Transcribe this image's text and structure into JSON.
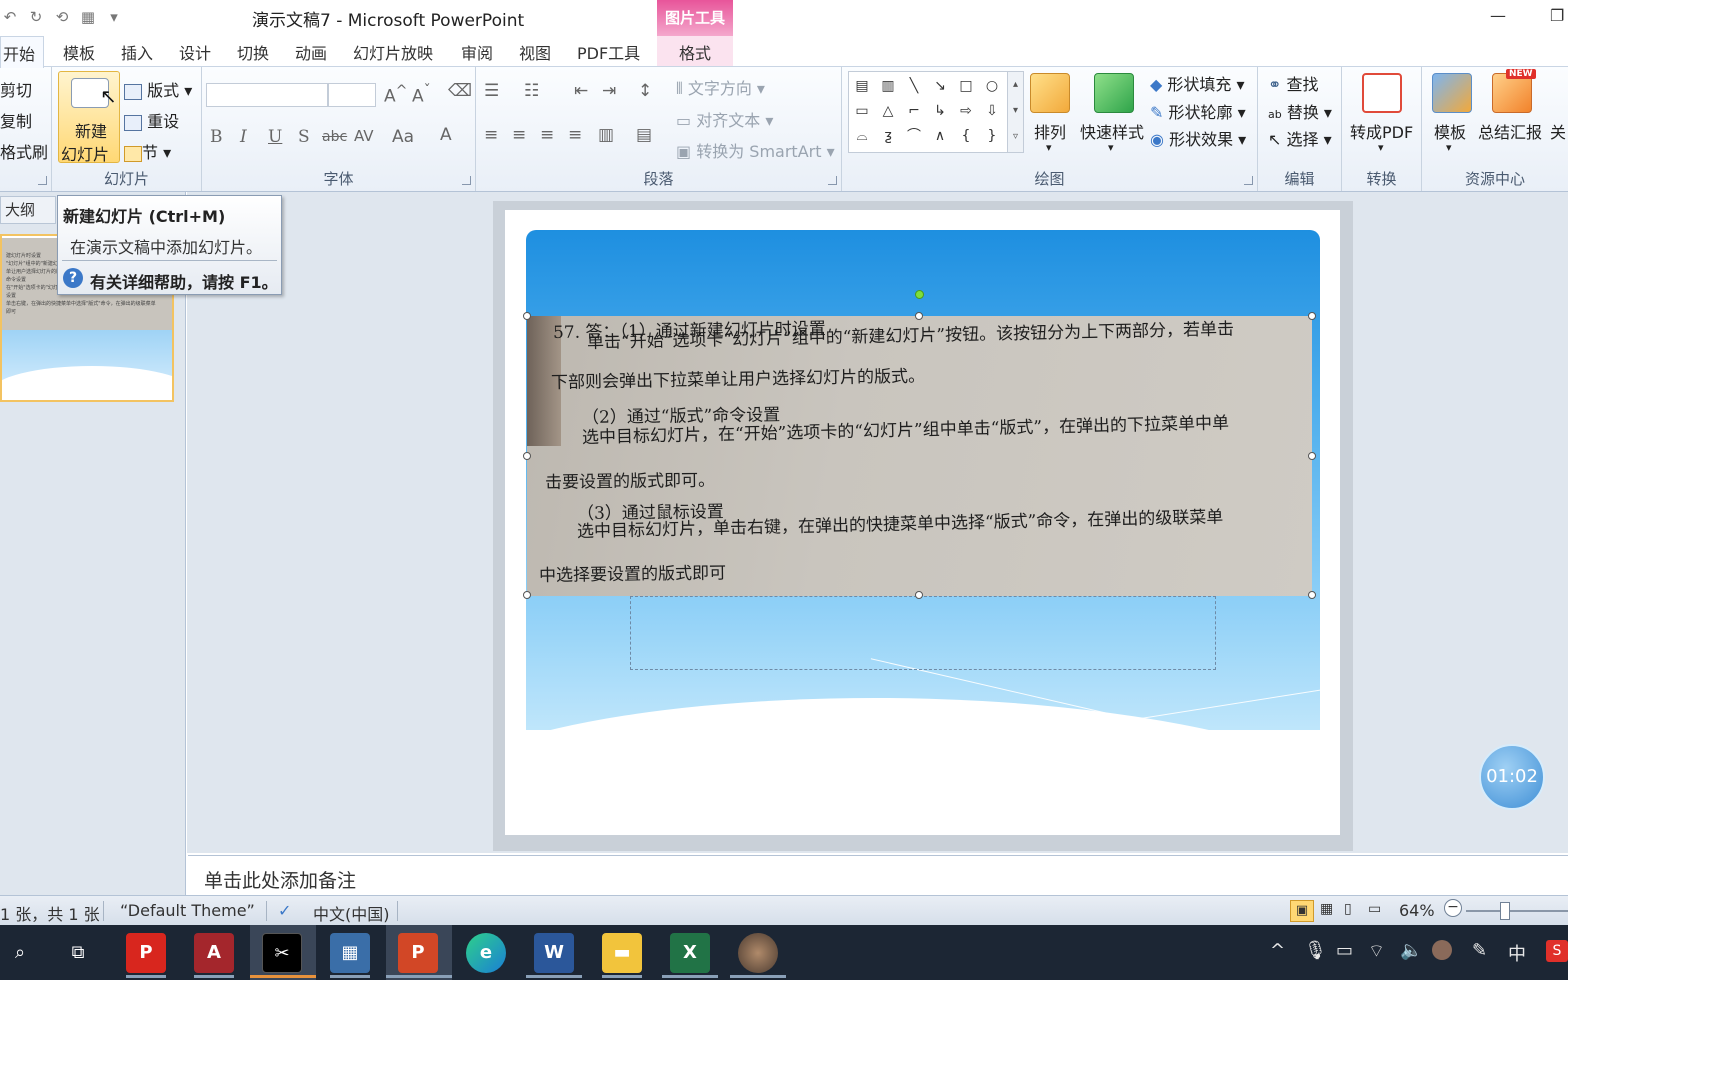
{
  "window": {
    "title": "演示文稿7 - Microsoft PowerPoint",
    "context_tab_group": "图片工具",
    "minimize_icon": "minimize-icon",
    "maximize_icon": "restore-icon"
  },
  "tabs": [
    "开始",
    "模板",
    "插入",
    "设计",
    "切换",
    "动画",
    "幻灯片放映",
    "审阅",
    "视图",
    "PDF工具",
    "格式"
  ],
  "active_tab": "开始",
  "ribbon": {
    "clipboard": {
      "cut": "剪切",
      "copy": "复制",
      "format_painter": "格式刷"
    },
    "slides": {
      "new_slide_line1": "新建",
      "new_slide_line2": "幻灯片",
      "layout": "版式",
      "reset": "重设",
      "section": "节",
      "label": "幻灯片"
    },
    "font": {
      "label": "字体",
      "bold": "B",
      "italic": "I",
      "underline": "U",
      "shadow": "S",
      "strikethrough": "abc",
      "spacing": "AV",
      "case": "Aa",
      "color": "A"
    },
    "paragraph": {
      "label": "段落",
      "text_direction": "文字方向",
      "align_text": "对齐文本",
      "convert_smartart": "转换为 SmartArt"
    },
    "drawing": {
      "label": "绘图",
      "arrange": "排列",
      "quick_styles": "快速样式",
      "shape_fill": "形状填充",
      "shape_outline": "形状轮廓",
      "shape_effects": "形状效果"
    },
    "editing": {
      "label": "编辑",
      "find": "查找",
      "replace": "替换",
      "select": "选择"
    },
    "convert": {
      "label": "转换",
      "to_pdf": "转成PDF"
    },
    "resources": {
      "label": "资源中心",
      "template": "模板",
      "summary_report": "总结汇报",
      "about": "关",
      "new_badge": "NEW"
    }
  },
  "tooltip": {
    "title": "新建幻灯片 (Ctrl+M)",
    "description": "在演示文稿中添加幻灯片。",
    "help": "有关详细帮助，请按 F1。"
  },
  "left_pane": {
    "outline_tab": "大纲"
  },
  "thumbnail_lines": [
    "建幻灯片时设置",
    "\"幻灯片\"组中的\"新建幻灯",
    "单让用户选择幻灯片的版式",
    "命令设置",
    "在\"开始\"选项卡的\"幻灯片",
    "设置",
    "单击右键，在弹出的快捷菜单中选择\"版式\"命令，在弹出的级联菜单",
    "即可"
  ],
  "slide_image_text": [
    "57. 答：（1）通过新建幻灯片时设置",
    "单击“开始”选项卡“幻灯片”组中的“新建幻灯片”按钮。该按钮分为上下两部分，若单击",
    "下部则会弹出下拉菜单让用户选择幻灯片的版式。",
    "（2）通过“版式”命令设置",
    "选中目标幻灯片，在“开始”选项卡的“幻灯片”组中单击“版式”，在弹出的下拉菜单中单",
    "击要设置的版式即可。",
    "（3）通过鼠标设置",
    "选中目标幻灯片，单击右键，在弹出的快捷菜单中选择“版式”命令，在弹出的级联菜单",
    "中选择要设置的版式即可"
  ],
  "timer": "01:02",
  "notes_placeholder": "单击此处添加备注",
  "status": {
    "slide_count": "1 张，共 1 张",
    "theme": "“Default Theme”",
    "language": "中文(中国)",
    "zoom": "64%"
  },
  "taskbar": {
    "apps": [
      "search-icon",
      "task-view-icon",
      "wps-pdf-icon",
      "access-icon",
      "capcut-icon",
      "calculator-icon",
      "powerpoint-icon",
      "edge-icon",
      "word-icon",
      "explorer-icon",
      "excel-icon",
      "user-photo-icon"
    ],
    "ime": "中"
  },
  "colors": {
    "slide_blue_top": "#1e8fe0",
    "slide_blue_bottom": "#bfe6fb",
    "context_tab": "#e8559a",
    "taskbar": "#1c2634"
  }
}
